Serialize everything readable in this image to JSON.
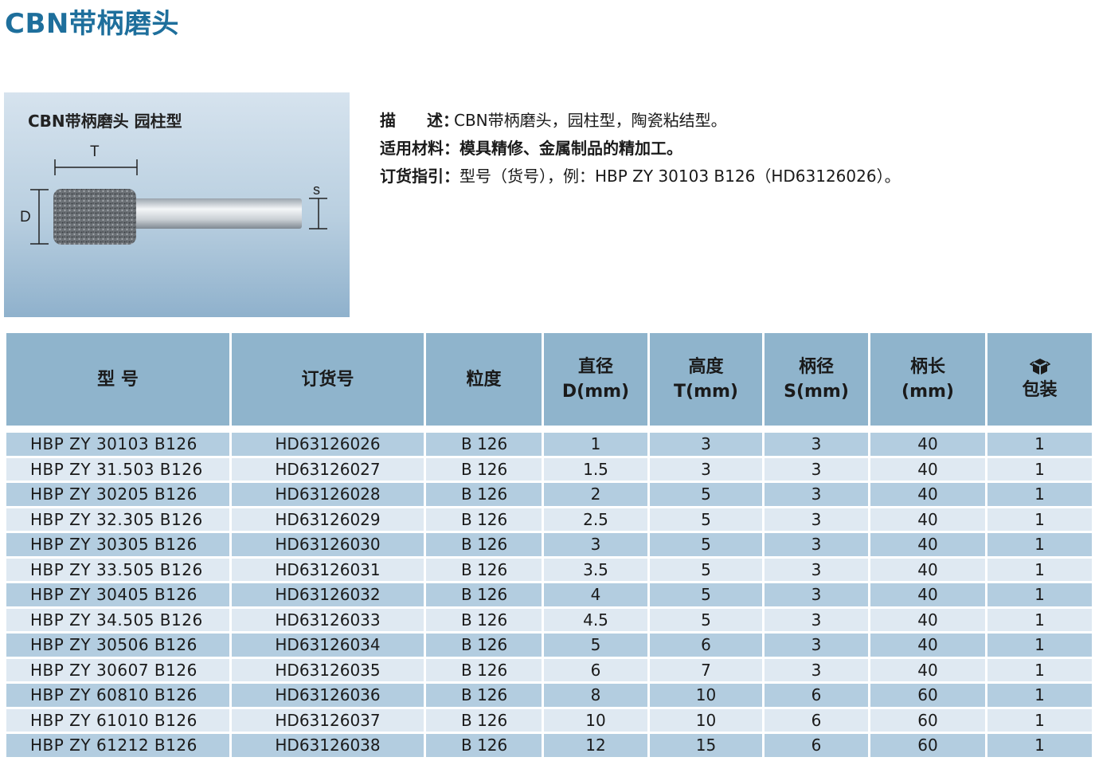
{
  "page": {
    "title": "CBN带柄磨头"
  },
  "figure": {
    "caption": "CBN带柄磨头 园柱型",
    "dim_t": "T",
    "dim_d": "D",
    "dim_s": "s"
  },
  "description": {
    "desc_label_a": "描",
    "desc_label_b": "述：",
    "desc_value": "CBN带柄磨头，园柱型，陶瓷粘结型。",
    "material_label": "适用材料：",
    "material_value": "模具精修、金属制品的精加工。",
    "order_label": "订货指引：",
    "order_value": "型号（货号），例：HBP ZY 30103 B126（HD63126026）。"
  },
  "table": {
    "headers": {
      "model": "型 号",
      "order_no": "订货号",
      "grain": "粒度",
      "diameter_line1": "直径",
      "diameter_line2": "D(mm)",
      "height_line1": "高度",
      "height_line2": "T(mm)",
      "shank_dia_line1": "柄径",
      "shank_dia_line2": "S(mm)",
      "shank_len_line1": "柄长",
      "shank_len_line2": "(mm)",
      "package_icon": "package-icon",
      "package": "包装"
    },
    "rows": [
      {
        "model": "HBP ZY 30103 B126",
        "order_no": "HD63126026",
        "grain": "B 126",
        "d": "1",
        "t": "3",
        "s": "3",
        "l": "40",
        "pack": "1"
      },
      {
        "model": "HBP ZY 31.503 B126",
        "order_no": "HD63126027",
        "grain": "B 126",
        "d": "1.5",
        "t": "3",
        "s": "3",
        "l": "40",
        "pack": "1"
      },
      {
        "model": "HBP ZY 30205 B126",
        "order_no": "HD63126028",
        "grain": "B 126",
        "d": "2",
        "t": "5",
        "s": "3",
        "l": "40",
        "pack": "1"
      },
      {
        "model": "HBP ZY 32.305 B126",
        "order_no": "HD63126029",
        "grain": "B 126",
        "d": "2.5",
        "t": "5",
        "s": "3",
        "l": "40",
        "pack": "1"
      },
      {
        "model": "HBP ZY 30305 B126",
        "order_no": "HD63126030",
        "grain": "B 126",
        "d": "3",
        "t": "5",
        "s": "3",
        "l": "40",
        "pack": "1"
      },
      {
        "model": "HBP ZY 33.505 B126",
        "order_no": "HD63126031",
        "grain": "B 126",
        "d": "3.5",
        "t": "5",
        "s": "3",
        "l": "40",
        "pack": "1"
      },
      {
        "model": "HBP ZY 30405 B126",
        "order_no": "HD63126032",
        "grain": "B 126",
        "d": "4",
        "t": "5",
        "s": "3",
        "l": "40",
        "pack": "1"
      },
      {
        "model": "HBP ZY 34.505 B126",
        "order_no": "HD63126033",
        "grain": "B 126",
        "d": "4.5",
        "t": "5",
        "s": "3",
        "l": "40",
        "pack": "1"
      },
      {
        "model": "HBP ZY 30506 B126",
        "order_no": "HD63126034",
        "grain": "B 126",
        "d": "5",
        "t": "6",
        "s": "3",
        "l": "40",
        "pack": "1"
      },
      {
        "model": "HBP ZY 30607 B126",
        "order_no": "HD63126035",
        "grain": "B 126",
        "d": "6",
        "t": "7",
        "s": "3",
        "l": "40",
        "pack": "1"
      },
      {
        "model": "HBP ZY 60810 B126",
        "order_no": "HD63126036",
        "grain": "B 126",
        "d": "8",
        "t": "10",
        "s": "6",
        "l": "60",
        "pack": "1"
      },
      {
        "model": "HBP ZY 61010 B126",
        "order_no": "HD63126037",
        "grain": "B 126",
        "d": "10",
        "t": "10",
        "s": "6",
        "l": "60",
        "pack": "1"
      },
      {
        "model": "HBP ZY 61212 B126",
        "order_no": "HD63126038",
        "grain": "B 126",
        "d": "12",
        "t": "15",
        "s": "6",
        "l": "60",
        "pack": "1"
      }
    ]
  },
  "colors": {
    "title": "#1e6f9c",
    "header_bg": "#8fb4cc",
    "row_dark": "#b3cde0",
    "row_light": "#dfe9f2"
  }
}
